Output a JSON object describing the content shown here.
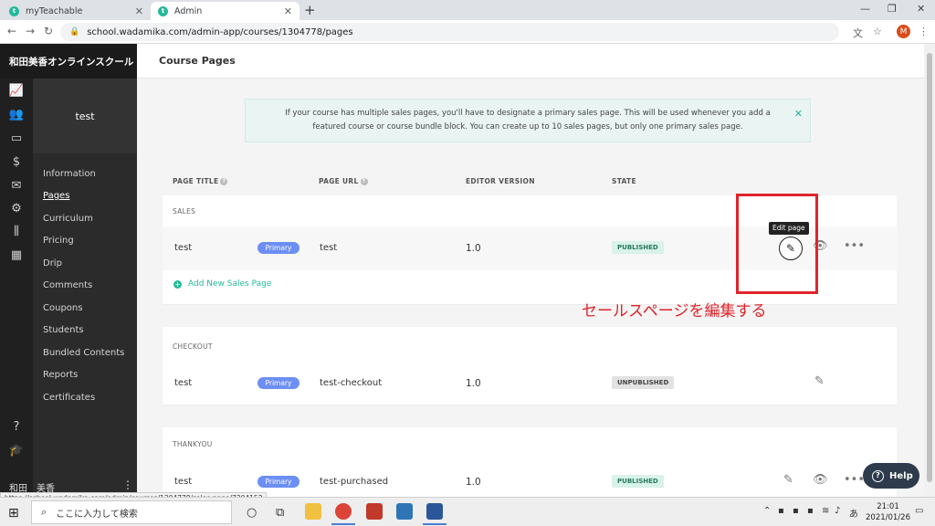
{
  "browser": {
    "tabs": [
      {
        "label": "myTeachable",
        "favicon": "t"
      },
      {
        "label": "Admin",
        "favicon": "t"
      }
    ],
    "url": "school.wadamika.com/admin-app/courses/1304778/pages",
    "profile_initial": "M",
    "status_url": "https://school.wadamika.com/admin/courses/1304778/sales-page/7304153"
  },
  "sidebar": {
    "brand": "和田美香オンラインスクール",
    "course_name": "test",
    "menu": [
      {
        "label": "Information",
        "active": false
      },
      {
        "label": "Pages",
        "active": true
      },
      {
        "label": "Curriculum",
        "active": false
      },
      {
        "label": "Pricing",
        "active": false
      },
      {
        "label": "Drip",
        "active": false
      },
      {
        "label": "Comments",
        "active": false
      },
      {
        "label": "Coupons",
        "active": false
      },
      {
        "label": "Students",
        "active": false
      },
      {
        "label": "Bundled Contents",
        "active": false
      },
      {
        "label": "Reports",
        "active": false
      },
      {
        "label": "Certificates",
        "active": false
      }
    ],
    "user_name": "和田　美香"
  },
  "main": {
    "title": "Course Pages",
    "notice": "If your course has multiple sales pages, you'll have to designate a primary sales page. This will be used whenever you add a featured course or course bundle block. You can create up to 10 sales pages, but only one primary sales page.",
    "columns": {
      "title": "PAGE TITLE",
      "url": "PAGE URL",
      "editor": "EDITOR VERSION",
      "state": "STATE"
    },
    "sections": {
      "sales": {
        "label": "SALES",
        "row": {
          "title": "test",
          "badge": "Primary",
          "url": "test",
          "version": "1.0",
          "state": "PUBLISHED"
        },
        "add_label": "Add New Sales Page"
      },
      "checkout": {
        "label": "CHECKOUT",
        "row": {
          "title": "test",
          "badge": "Primary",
          "url": "test-checkout",
          "version": "1.0",
          "state": "UNPUBLISHED"
        }
      },
      "thankyou": {
        "label": "THANKYOU",
        "row": {
          "title": "test",
          "badge": "Primary",
          "url": "test-purchased",
          "version": "1.0",
          "state": "PUBLISHED"
        }
      }
    },
    "tooltip": "Edit page",
    "annotation": "セールスページを編集する",
    "help_label": "Help"
  },
  "taskbar": {
    "search_placeholder": "ここに入力して検索",
    "time": "21:01",
    "date": "2021/01/26",
    "ime": "あ"
  },
  "colors": {
    "accent": "#25b99a",
    "pill": "#6c8ef5",
    "annotation": "#e0242b",
    "sidebar": "#2b2b2b"
  }
}
